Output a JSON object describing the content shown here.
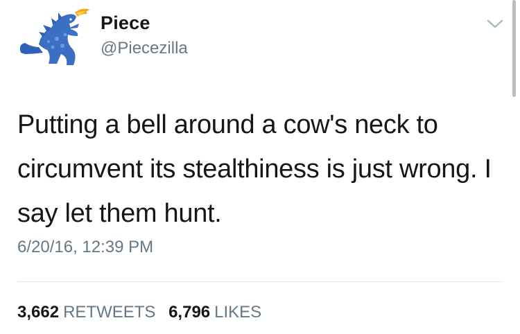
{
  "author": {
    "name": "Piece",
    "handle": "@Piecezilla",
    "avatar_icon": "godzilla-avatar-icon"
  },
  "tweet": {
    "text": "Putting a bell around a cow's neck to circumvent its stealthiness is just wrong. I say let them hunt.",
    "timestamp": "6/20/16, 12:39 PM"
  },
  "stats": {
    "retweets_count": "3,662",
    "retweets_label": "RETWEETS",
    "likes_count": "6,796",
    "likes_label": "LIKES"
  },
  "menu": {
    "icon": "chevron-down-icon"
  },
  "colors": {
    "text": "#14171a",
    "secondary": "#657786",
    "avatar_blue": "#3a6fc4",
    "fire": "#f5a623"
  }
}
